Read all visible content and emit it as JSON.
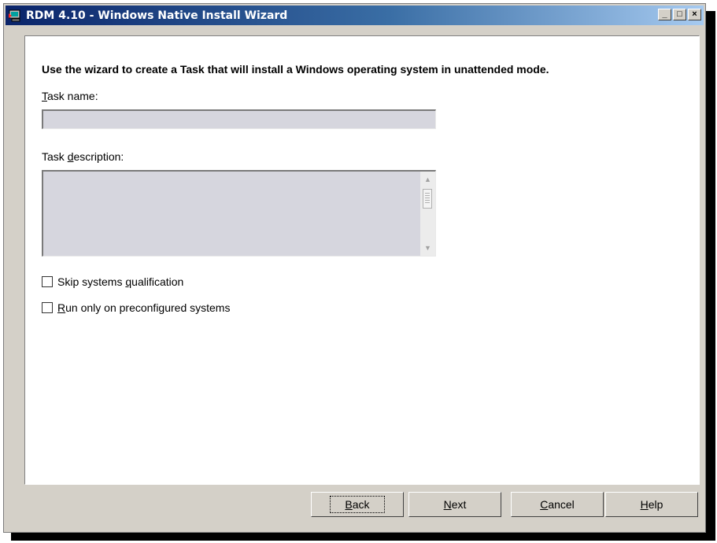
{
  "window": {
    "title": "RDM 4.10 - Windows Native Install Wizard",
    "minimize_glyph": "_",
    "maximize_glyph": "□",
    "close_glyph": "×"
  },
  "form": {
    "heading": "Use the wizard to create a Task that will install a Windows operating system in unattended mode.",
    "task_name_label": {
      "mnemonic": "T",
      "rest": "ask name:"
    },
    "task_name_value": "",
    "task_description_label": {
      "before": "Task ",
      "mnemonic": "d",
      "after": "escription:"
    },
    "task_description_value": "",
    "skip_qualification": {
      "before": "Skip systems ",
      "mnemonic": "q",
      "after": "ualification",
      "checked": false
    },
    "run_preconfigured": {
      "mnemonic": "R",
      "after": "un only on preconfigured systems",
      "checked": false
    }
  },
  "buttons": {
    "back": {
      "mnemonic": "B",
      "rest": "ack"
    },
    "next": {
      "mnemonic": "N",
      "rest": "ext"
    },
    "cancel": {
      "mnemonic": "C",
      "rest": "ancel"
    },
    "help": {
      "mnemonic": "H",
      "rest": "elp"
    }
  },
  "colors": {
    "titlebar_start": "#0a246a",
    "titlebar_end": "#a6caf0",
    "field_background": "#d6d6de",
    "window_background": "#d4d0c8"
  },
  "icons": {
    "app": "computer-icon",
    "scroll_up": "triangle-up-icon",
    "scroll_down": "triangle-down-icon"
  }
}
